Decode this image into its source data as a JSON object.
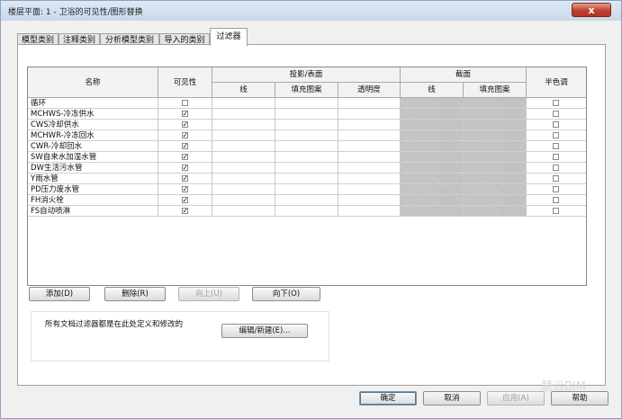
{
  "window": {
    "title": "楼层平面: 1 - 卫浴的可见性/图形替换",
    "close_label": "x"
  },
  "tabs": [
    "模型类别",
    "注释类别",
    "分析模型类别",
    "导入的类别",
    "过滤器"
  ],
  "table": {
    "header": {
      "name": "名称",
      "visibility": "可见性",
      "projection_surface": "投影/表面",
      "line": "线",
      "fill_pattern": "填充图案",
      "transparency": "透明度",
      "cut": "截面",
      "cut_line": "线",
      "cut_fill_pattern": "填充图案",
      "halftone": "半色调"
    },
    "rows": [
      {
        "name": "循环",
        "visible": false
      },
      {
        "name": "MCHWS-冷冻供水",
        "visible": true
      },
      {
        "name": "CWS冷却供水",
        "visible": true
      },
      {
        "name": "MCHWR-冷冻回水",
        "visible": true
      },
      {
        "name": "CWR-冷却回水",
        "visible": true
      },
      {
        "name": "SW自来水加湿水管",
        "visible": true
      },
      {
        "name": "DW生活污水管",
        "visible": true
      },
      {
        "name": "Y雨水管",
        "visible": true
      },
      {
        "name": "PD压力废水管",
        "visible": true
      },
      {
        "name": "FH消火栓",
        "visible": true
      },
      {
        "name": "FS自动喷淋",
        "visible": true
      }
    ]
  },
  "actions": {
    "add": "添加(D)",
    "delete": "删除(R)",
    "up": "向上(U)",
    "down": "向下(O)"
  },
  "filter_note": "所有文档过滤器都是在此处定义和修改的",
  "edit_new": "编辑/新建(E)...",
  "footer": {
    "ok": "确定",
    "cancel": "取消",
    "apply": "应用(A)",
    "help": "帮助"
  },
  "watermark": "慧远BIM"
}
